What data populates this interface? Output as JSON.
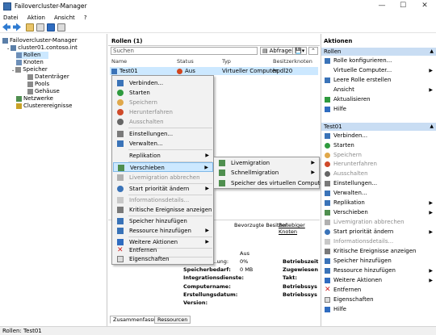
{
  "window": {
    "title": "Failovercluster-Manager",
    "minimize": "—",
    "maximize": "☐",
    "close": "✕"
  },
  "menu": [
    "Datei",
    "Aktion",
    "Ansicht",
    "?"
  ],
  "tree": {
    "root": "Failovercluster-Manager",
    "cluster": "cluster01.contoso.int",
    "rollen": "Rollen",
    "knoten": "Knoten",
    "speicher": "Speicher",
    "datentraeger": "Datenträger",
    "pools": "Pools",
    "gehaeuse": "Gehäuse",
    "netzwerke": "Netzwerke",
    "clusterereignisse": "Clusterereignisse"
  },
  "center": {
    "header": "Rollen (1)",
    "search_placeholder": "Suchen",
    "abfragen": "Abfragen",
    "columns": [
      "Name",
      "Status",
      "Typ",
      "Besitzerknoten"
    ],
    "role": {
      "name": "Test01",
      "status": "Aus",
      "type": "Virtueller Computer",
      "owner": "hpdl20"
    },
    "preferred_owner_label": "Bevorzugte Besitzer:",
    "preferred_owner_link": "Beliebiger Knoten",
    "details": {
      "aus": "Aus",
      "nutzung_label": "…ung:",
      "nutzung_value": "0%",
      "speicherbedarf_label": "Speicherbedarf:",
      "speicherbedarf_value": "0 MB",
      "integrationsdienste_label": "Integrationsdienste:",
      "computername_label": "Computername:",
      "erstellungsdatum_label": "Erstellungsdatum:",
      "version_label": "Version:",
      "right1": "Betriebszeit",
      "right2": "Zugewiesen",
      "right3": "Takt:",
      "right4": "Betriebssys",
      "right5": "Betriebssys"
    },
    "tabs": [
      "Zusammenfassung",
      "Ressourcen"
    ]
  },
  "context_menu": {
    "items": [
      "Verbinden...",
      "Starten",
      "Speichern",
      "Herunterfahren",
      "Ausschalten",
      "Einstellungen...",
      "Verwalten...",
      "Replikation",
      "Verschieben",
      "Livemigration abbrechen",
      "Start priorität ändern",
      "Informationsdetails...",
      "Kritische Ereignisse anzeigen",
      "Speicher hinzufügen",
      "Ressource hinzufügen",
      "Weitere Aktionen",
      "Entfernen",
      "Eigenschaften"
    ]
  },
  "submenu": {
    "items": [
      "Livemigration",
      "Schnellmigration",
      "Speicher des virtuellen Computers"
    ]
  },
  "actions": {
    "header": "Aktionen",
    "section1": "Rollen",
    "s1_items": [
      "Rolle konfigurieren...",
      "Virtuelle Computer...",
      "Leere Rolle erstellen",
      "Ansicht",
      "Aktualisieren",
      "Hilfe"
    ],
    "section2": "Test01",
    "s2_items": [
      "Verbinden...",
      "Starten",
      "Speichern",
      "Herunterfahren",
      "Ausschalten",
      "Einstellungen...",
      "Verwalten...",
      "Replikation",
      "Verschieben",
      "Livemigration abbrechen",
      "Start priorität ändern",
      "Informationsdetails...",
      "Kritische Ereignisse anzeigen",
      "Speicher hinzufügen",
      "Ressource hinzufügen",
      "Weitere Aktionen",
      "Entfernen",
      "Eigenschaften",
      "Hilfe"
    ]
  },
  "status": "Rollen: Test01",
  "colors": {
    "selection": "#cce8ff",
    "section_header": "#c9ddf3",
    "accent": "#1a73c9"
  }
}
